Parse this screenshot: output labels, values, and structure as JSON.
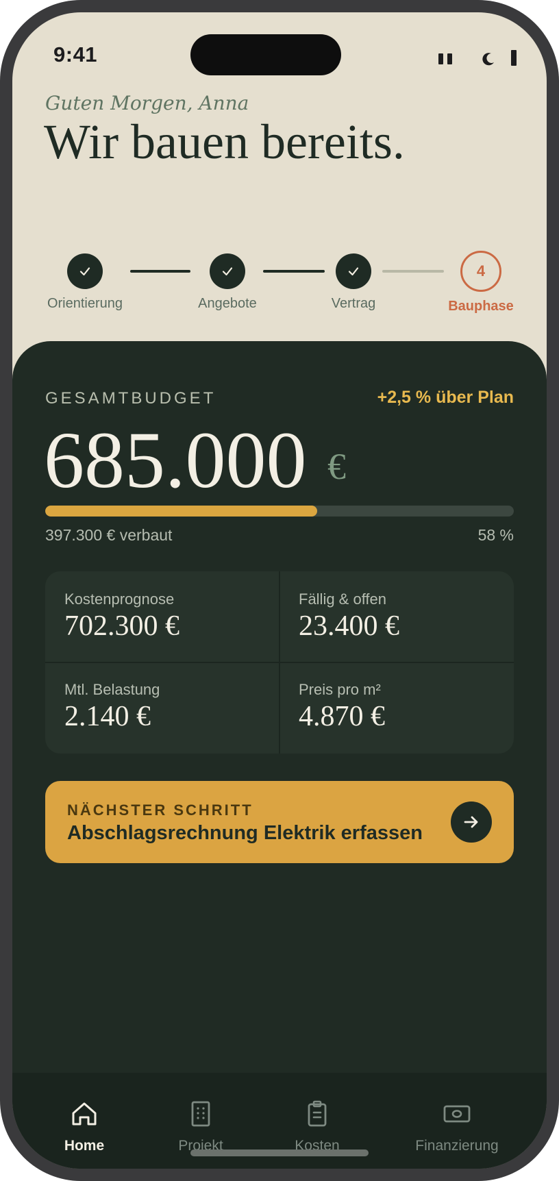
{
  "status_bar": {
    "time": "9:41",
    "signal_icon": "signal-icon",
    "focus_icon": "moon-icon",
    "battery_icon": "battery-icon"
  },
  "header": {
    "greeting": "Guten Morgen, Anna",
    "headline": "Wir bauen bereits."
  },
  "stepper": {
    "steps": [
      {
        "label": "Orientierung",
        "state": "done",
        "icon": "check-icon"
      },
      {
        "label": "Angebote",
        "state": "done",
        "icon": "check-icon"
      },
      {
        "label": "Vertrag",
        "state": "done",
        "icon": "check-icon"
      },
      {
        "label": "Bauphase",
        "state": "current",
        "number": "4"
      }
    ]
  },
  "budget": {
    "label": "GESAMTBUDGET",
    "delta": "+2,5 % über Plan",
    "amount": "685.000",
    "currency": "€",
    "progress_fraction": 0.58,
    "spent": "397.300 € verbaut",
    "percent": "58 %"
  },
  "stats": [
    {
      "label": "Kostenprognose",
      "value": "702.300 €"
    },
    {
      "label": "Fällig & offen",
      "value": "23.400 €"
    },
    {
      "label": "Mtl. Belastung",
      "value": "2.140 €"
    },
    {
      "label": "Preis pro m²",
      "value": "4.870 €"
    }
  ],
  "next_step": {
    "kicker": "NÄCHSTER SCHRITT",
    "title": "Abschlagsrechnung Elektrik erfassen",
    "icon": "arrow-right-icon"
  },
  "tabbar": {
    "tabs": [
      {
        "label": "Home",
        "icon": "home-icon",
        "active": true
      },
      {
        "label": "Projekt",
        "icon": "building-icon",
        "active": false
      },
      {
        "label": "Kosten",
        "icon": "clipboard-icon",
        "active": false
      },
      {
        "label": "Finanzierung",
        "icon": "banknote-icon",
        "active": false
      }
    ]
  },
  "colors": {
    "cream": "#e5dfcf",
    "forest": "#1f2b24",
    "card": "#202b24",
    "accent_gold": "#dba442",
    "accent_terracotta": "#cb6a44"
  }
}
